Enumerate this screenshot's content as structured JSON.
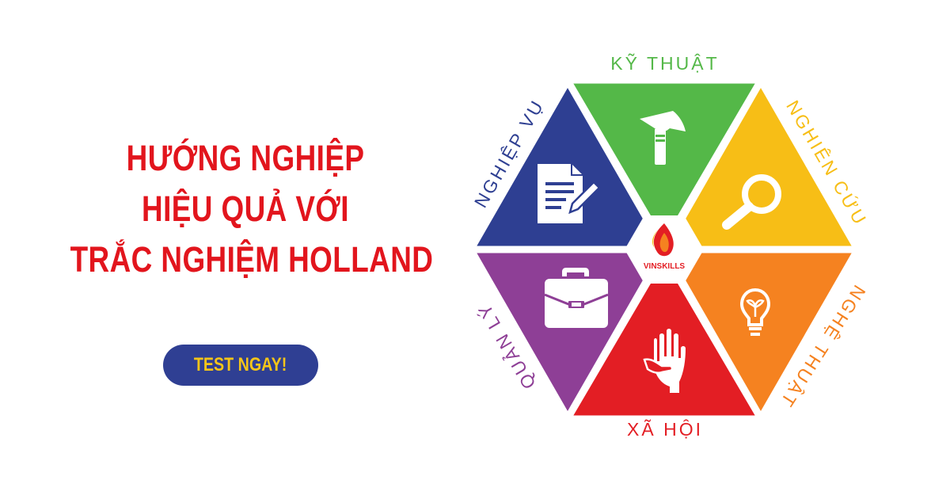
{
  "headline": {
    "line1": "HƯỚNG NGHIỆP",
    "line2": "HIỆU QUẢ VỚI",
    "line3": "TRẮC NGHIỆM HOLLAND"
  },
  "cta": {
    "label": "TEST NGAY!"
  },
  "logo": {
    "text": "VINSKILLS"
  },
  "segments": [
    {
      "label": "KỸ THUẬT",
      "color": "#54b848",
      "icon": "hammer-icon"
    },
    {
      "label": "NGHIÊN CỨU",
      "color": "#f7be16",
      "icon": "magnifier-icon"
    },
    {
      "label": "NGHỆ THUẬT",
      "color": "#f58220",
      "icon": "lightbulb-icon"
    },
    {
      "label": "XÃ HỘI",
      "color": "#e31e24",
      "icon": "hand-icon"
    },
    {
      "label": "QUẢN LÝ",
      "color": "#8e3f96",
      "icon": "briefcase-icon"
    },
    {
      "label": "NGHIỆP VỤ",
      "color": "#2e3f92",
      "icon": "document-pen-icon"
    }
  ]
}
